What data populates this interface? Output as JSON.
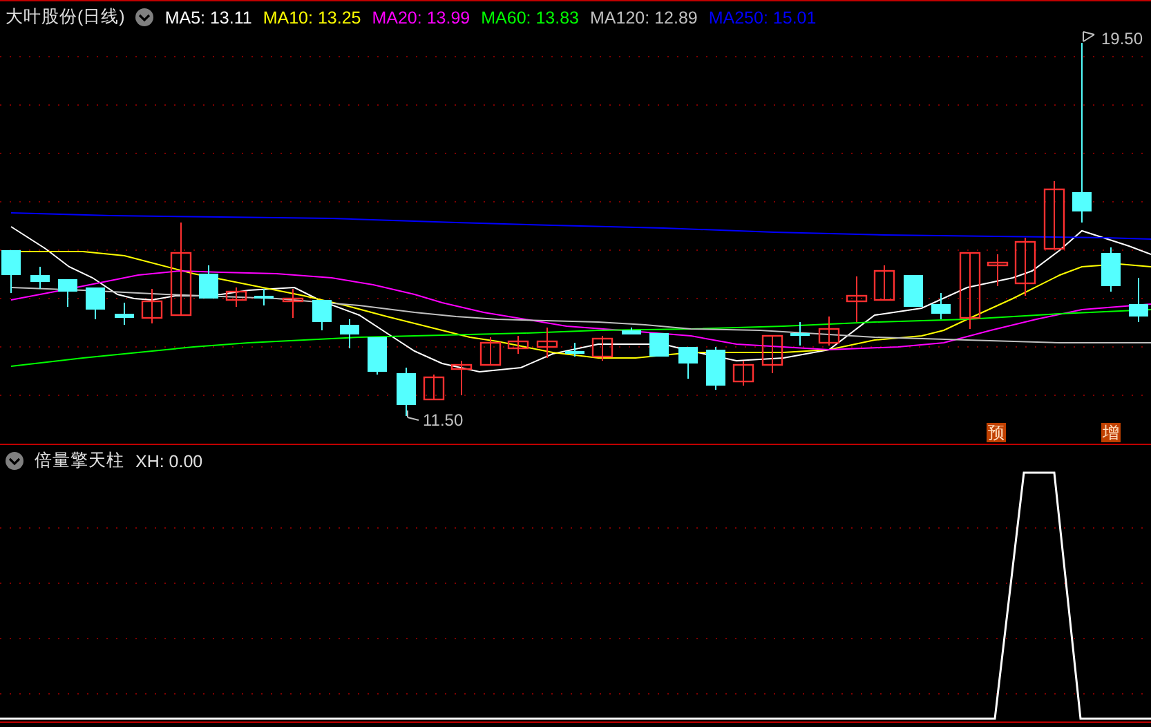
{
  "chart": {
    "title": "大叶股份(日线)",
    "moving_averages": [
      {
        "label": "MA5: 13.11",
        "color": "#ffffff"
      },
      {
        "label": "MA10: 13.25",
        "color": "#ffff00"
      },
      {
        "label": "MA20: 13.99",
        "color": "#ff00ff"
      },
      {
        "label": "MA60: 13.83",
        "color": "#00ff00"
      },
      {
        "label": "MA120: 12.89",
        "color": "#c0c0c0"
      },
      {
        "label": "MA250: 15.01",
        "color": "#0000ff"
      }
    ],
    "high_label": "19.50",
    "low_label": "11.50",
    "signal_badges": [
      "预",
      "增"
    ]
  },
  "indicator": {
    "title": "倍量擎天柱",
    "readings": [
      "XH: 0.00"
    ]
  }
}
